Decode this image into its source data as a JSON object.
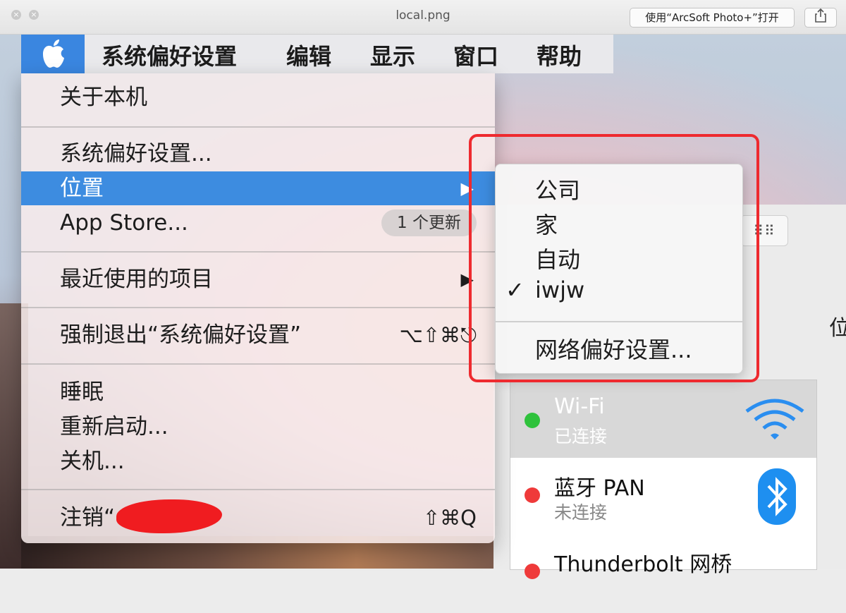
{
  "window": {
    "title": "local.png",
    "open_button": "使用“ArcSoft Photo+”打开",
    "share_icon": "share-icon"
  },
  "menubar": {
    "apple_icon": "apple-logo-icon",
    "items": [
      "系统偏好设置",
      "编辑",
      "显示",
      "窗口",
      "帮助"
    ]
  },
  "apple_menu": {
    "about": "关于本机",
    "system_prefs": "系统偏好设置...",
    "location": "位置",
    "app_store": "App Store...",
    "app_store_badge": "1 个更新",
    "recent_items": "最近使用的项目",
    "force_quit": "强制退出“系统偏好设置”",
    "force_quit_shortcut": "⌥⇧⌘⎋",
    "sleep": "睡眠",
    "restart": "重新启动...",
    "shutdown": "关机...",
    "logout_prefix": "注销“",
    "logout_suffix": "”...",
    "logout_shortcut": "⇧⌘Q"
  },
  "location_submenu": {
    "items": [
      "公司",
      "家",
      "自动",
      "iwjw"
    ],
    "checked": "iwjw",
    "network_prefs": "网络偏好设置..."
  },
  "prefs_window": {
    "side_char": "位",
    "networks": [
      {
        "name": "Wi-Fi",
        "status": "已连接",
        "status_color": "#2fc23c"
      },
      {
        "name": "蓝牙 PAN",
        "status": "未连接",
        "status_color": "#ef3a3a"
      },
      {
        "name": "Thunderbolt 网桥",
        "status": "",
        "status_color": "#ef3a3a"
      }
    ]
  }
}
